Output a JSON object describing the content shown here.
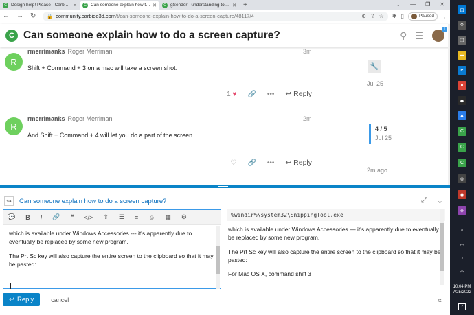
{
  "browser": {
    "tabs": [
      {
        "label": "Design help! Please - Carbide 3D",
        "active": false
      },
      {
        "label": "Can someone explain how to do",
        "active": true
      },
      {
        "label": "gSender - understanding tool m",
        "active": false
      }
    ],
    "new_tab": "+",
    "url_host": "community.carbide3d.com",
    "url_path": "/t/can-someone-explain-how-to-do-a-screen-capture/48117/4",
    "profile_status": "Paused"
  },
  "header": {
    "logo_letter": "C",
    "title": "Can someone explain how to do a screen capture?",
    "notification_count": "1"
  },
  "posts": [
    {
      "avatar_letter": "R",
      "username": "rmerrimanks",
      "full_name": "Roger Merriman",
      "time": "3m",
      "text": "Shift + Command + 3 on a mac will take a screen shot.",
      "like_count": "1",
      "reply_label": "Reply"
    },
    {
      "avatar_letter": "R",
      "username": "rmerrimanks",
      "full_name": "Roger Merriman",
      "time": "2m",
      "text": "And Shift + Command + 4 will let you do a part of the screen.",
      "like_count": "",
      "reply_label": "Reply"
    }
  ],
  "timeline": {
    "start_date": "Jul 25",
    "position": "4 / 5",
    "position_date": "Jul 25",
    "end_label": "2m ago"
  },
  "composer": {
    "reply_to_title": "Can someone explain how to do a screen capture?",
    "editor_paragraphs": [
      "which is available under Windows Accessories --- it's apparently due to eventually be replaced by some new program.",
      "The Prt Sc key will also capture the entire screen to the clipboard so that it may be pasted:"
    ],
    "preview_code": "%windir%\\system32\\SnippingTool.exe",
    "preview_paragraphs": [
      "which is available under Windows Accessories — it's apparently due to eventually be replaced by some new program.",
      "The Prt Sc key will also capture the entire screen to the clipboard so that it may be pasted:",
      "For Mac OS X, command shift 3"
    ],
    "reply_button": "Reply",
    "cancel_label": "cancel"
  },
  "taskbar": {
    "time": "10:04 PM",
    "date": "7/25/2022",
    "notifications": "2"
  },
  "colors": {
    "accent": "#0a84c8",
    "avatar_green": "#6ed05e",
    "heart": "#e54a6e"
  }
}
